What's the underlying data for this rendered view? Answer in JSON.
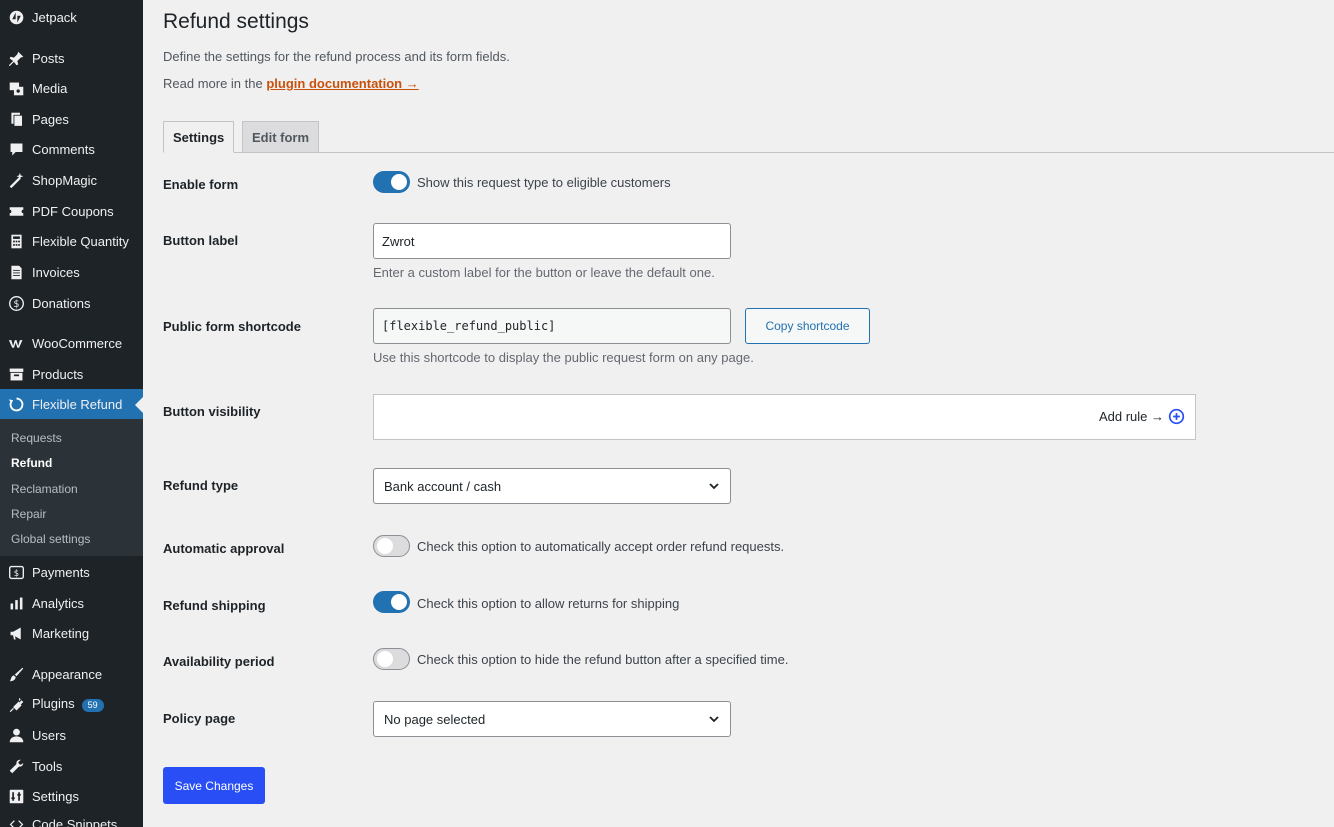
{
  "sidebar": {
    "items": [
      {
        "label": "Jetpack",
        "icon": "jetpack-icon"
      },
      {
        "label": "Posts",
        "icon": "pin-icon"
      },
      {
        "label": "Media",
        "icon": "media-icon"
      },
      {
        "label": "Pages",
        "icon": "pages-icon"
      },
      {
        "label": "Comments",
        "icon": "comment-icon"
      },
      {
        "label": "ShopMagic",
        "icon": "magic-wand-icon"
      },
      {
        "label": "PDF Coupons",
        "icon": "coupon-icon"
      },
      {
        "label": "Flexible Quantity",
        "icon": "calculator-icon"
      },
      {
        "label": "Invoices",
        "icon": "invoice-icon"
      },
      {
        "label": "Donations",
        "icon": "dollar-circle-icon"
      },
      {
        "label": "WooCommerce",
        "icon": "woocommerce-icon"
      },
      {
        "label": "Products",
        "icon": "archive-icon"
      },
      {
        "label": "Flexible Refund",
        "icon": "refresh-icon"
      },
      {
        "label": "Payments",
        "icon": "payments-icon"
      },
      {
        "label": "Analytics",
        "icon": "bar-chart-icon"
      },
      {
        "label": "Marketing",
        "icon": "megaphone-icon"
      },
      {
        "label": "Appearance",
        "icon": "paintbrush-icon"
      },
      {
        "label": "Plugins",
        "icon": "plugin-icon",
        "badge": "59"
      },
      {
        "label": "Users",
        "icon": "user-icon"
      },
      {
        "label": "Tools",
        "icon": "wrench-icon"
      },
      {
        "label": "Settings",
        "icon": "settings-icon"
      },
      {
        "label": "Code Snippets",
        "icon": "code-icon"
      }
    ],
    "submenu": [
      "Requests",
      "Refund",
      "Reclamation",
      "Repair",
      "Global settings"
    ],
    "active_item": "Flexible Refund",
    "current_submenu": "Refund"
  },
  "page": {
    "title": "Refund settings",
    "description": "Define the settings for the refund process and its form fields.",
    "readmore_prefix": "Read more in the",
    "readmore_link": "plugin documentation →"
  },
  "tabs": [
    {
      "label": "Settings",
      "active": true
    },
    {
      "label": "Edit form",
      "active": false
    }
  ],
  "fields": {
    "enable_form": {
      "label": "Enable form",
      "enabled": true,
      "text": "Show this request type to eligible customers"
    },
    "button_label": {
      "label": "Button label",
      "value": "Zwrot",
      "help": "Enter a custom label for the button or leave the default one."
    },
    "shortcode": {
      "label": "Public form shortcode",
      "value": "[flexible_refund_public]",
      "button": "Copy shortcode",
      "help": "Use this shortcode to display the public request form on any page."
    },
    "button_visibility": {
      "label": "Button visibility",
      "add_rule": "Add rule →"
    },
    "refund_type": {
      "label": "Refund type",
      "value": "Bank account / cash"
    },
    "automatic_approval": {
      "label": "Automatic approval",
      "enabled": false,
      "text": "Check this option to automatically accept order refund requests."
    },
    "refund_shipping": {
      "label": "Refund shipping",
      "enabled": true,
      "text": "Check this option to allow returns for shipping"
    },
    "availability_period": {
      "label": "Availability period",
      "enabled": false,
      "text": "Check this option to hide the refund button after a specified time."
    },
    "policy_page": {
      "label": "Policy page",
      "value": "No page selected"
    }
  },
  "save_button": "Save Changes",
  "colors": {
    "sidebar_bg": "#1d2327",
    "accent": "#2271b1",
    "primary_button": "#2a4ef5",
    "link": "#c9510c"
  }
}
